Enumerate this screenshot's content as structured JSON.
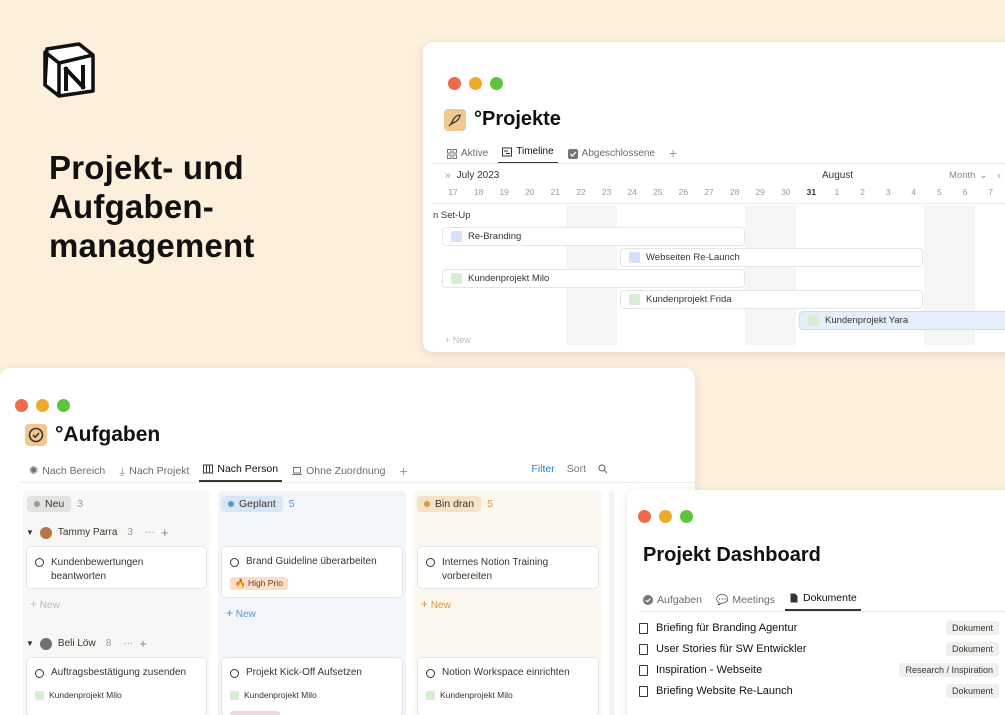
{
  "headline": [
    "Projekt- und",
    "Aufgaben-",
    "management"
  ],
  "colors": {
    "background": "#fcefdc",
    "accent_blue": "#2f7fd5",
    "high_prio_bg": "#fadec9"
  },
  "projekte": {
    "title": "°Projekte",
    "tabs": [
      {
        "label": "Aktive",
        "icon": "grid-icon"
      },
      {
        "label": "Timeline",
        "icon": "timeline-icon",
        "active": true
      },
      {
        "label": "Abgeschlossene",
        "icon": "checkbox-icon"
      }
    ],
    "month_left": "July 2023",
    "month_right": "August",
    "zoom": "Month",
    "days": [
      "17",
      "18",
      "19",
      "20",
      "21",
      "22",
      "23",
      "24",
      "25",
      "26",
      "27",
      "28",
      "29",
      "30",
      "31",
      "1",
      "2",
      "3",
      "4",
      "5",
      "6",
      "7"
    ],
    "today": "31",
    "group": "n Set-Up",
    "bars": [
      {
        "label": "Re-Branding",
        "icon": "rocket-blue-icon"
      },
      {
        "label": "Webseiten Re-Launch",
        "icon": "rocket-blue-icon"
      },
      {
        "label": "Kundenprojekt Milo",
        "icon": "rocket-green-icon"
      },
      {
        "label": "Kundenprojekt Frida",
        "icon": "rocket-green-icon"
      },
      {
        "label": "Kundenprojekt Yara",
        "icon": "rocket-green-icon"
      }
    ],
    "new_label": "+ New"
  },
  "aufgaben": {
    "title": "°Aufgaben",
    "tabs": [
      {
        "label": "Nach Bereich",
        "icon": "sun-icon"
      },
      {
        "label": "Nach Projekt",
        "icon": "pin-icon"
      },
      {
        "label": "Nach Person",
        "icon": "board-icon",
        "active": true
      },
      {
        "label": "Ohne Zuordnung",
        "icon": "laptop-icon"
      }
    ],
    "filter": "Filter",
    "sort": "Sort",
    "columns": [
      {
        "label": "Neu",
        "count": "3"
      },
      {
        "label": "Geplant",
        "count": "5"
      },
      {
        "label": "Bin dran",
        "count": "5"
      }
    ],
    "groups": [
      {
        "name": "Tammy Parra",
        "count": "3"
      },
      {
        "name": "Beli Löw",
        "count": "8"
      }
    ],
    "cards_row1": [
      {
        "title": "Kundenbewertungen beantworten"
      },
      {
        "title": "Brand Guideline überarbeiten",
        "tag": "🔥 High Prio"
      },
      {
        "title": "Internes Notion Training vorbereiten"
      }
    ],
    "cards_row2": [
      {
        "title": "Auftragsbestätigung zusenden",
        "project": "Kundenprojekt Milo"
      },
      {
        "title": "Projekt Kick-Off Aufsetzen",
        "project": "Kundenprojekt Milo"
      },
      {
        "title": "Notion Workspace einrichten",
        "project": "Kundenprojekt Milo"
      }
    ],
    "new_label": "New"
  },
  "dashboard": {
    "title": "Projekt Dashboard",
    "tabs": [
      {
        "label": "Aufgaben",
        "icon": "check-circle-icon"
      },
      {
        "label": "Meetings",
        "icon": "chat-icon"
      },
      {
        "label": "Dokumente",
        "icon": "document-icon",
        "active": true
      }
    ],
    "documents": [
      {
        "title": "Briefing für Branding Agentur",
        "tag": "Dokument"
      },
      {
        "title": "User Stories für SW Entwickler",
        "tag": "Dokument"
      },
      {
        "title": "Inspiration - Webseite",
        "tag": "Research / Inspiration"
      },
      {
        "title": "Briefing Website Re-Launch",
        "tag": "Dokument"
      }
    ]
  }
}
